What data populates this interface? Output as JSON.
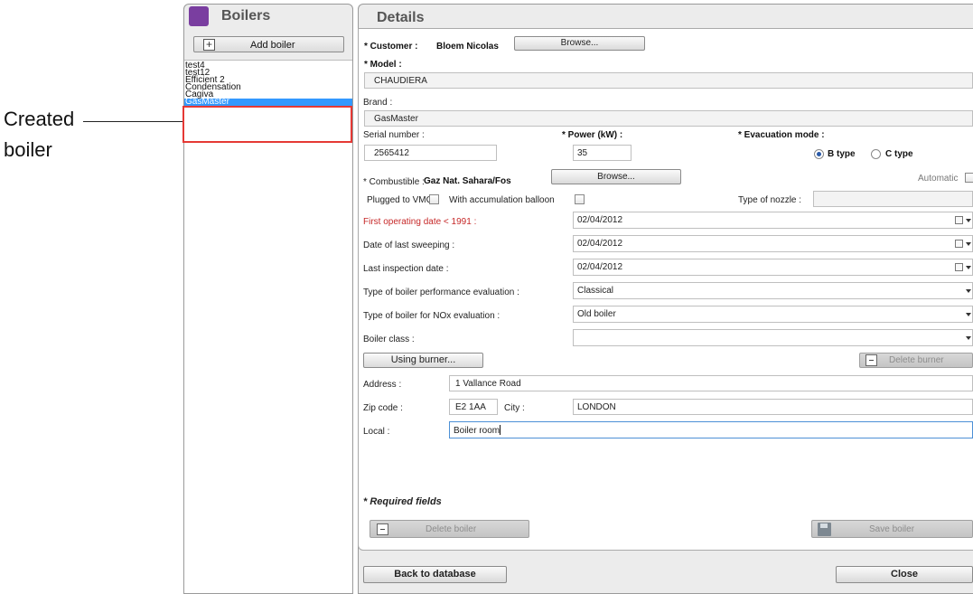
{
  "annotation": {
    "line1": "Created",
    "line2": "boiler"
  },
  "boilers_panel": {
    "title": "Boilers",
    "add_label": "Add boiler",
    "items": [
      {
        "label": "test4"
      },
      {
        "label": "test12"
      },
      {
        "label": "Efficient 2"
      },
      {
        "label": "Condensation"
      },
      {
        "label": "Cagiva"
      },
      {
        "label": "GasMaster",
        "selected": true
      }
    ]
  },
  "details": {
    "title": "Details",
    "customer": {
      "label": "Customer :",
      "value": "Bloem Nicolas",
      "browse_label": "Browse..."
    },
    "model": {
      "label": "Model :",
      "value": "CHAUDIERA"
    },
    "brand": {
      "label": "Brand :",
      "value": "GasMaster"
    },
    "serial": {
      "label": "Serial number :",
      "value": "2565412"
    },
    "power": {
      "label": "Power (kW) :",
      "value": "35"
    },
    "evacuation": {
      "label": "Evacuation mode :",
      "options": [
        "B type",
        "C type"
      ],
      "selected": "B type"
    },
    "combustible": {
      "label": "Combustible :",
      "value": "Gaz Nat. Sahara/Fos",
      "browse_label": "Browse..."
    },
    "automatic_label": "Automatic",
    "plugged_vmc_label": "Plugged to VMC",
    "accumulation_label": "With accumulation balloon",
    "nozzle_label": "Type of nozzle :",
    "first_operating": {
      "label": "First operating date < 1991 :",
      "value": "02/04/2012"
    },
    "last_sweeping": {
      "label": "Date of last sweeping :",
      "value": "02/04/2012"
    },
    "last_inspection": {
      "label": "Last inspection date :",
      "value": "02/04/2012"
    },
    "performance_eval": {
      "label": "Type of boiler performance evaluation :",
      "value": "Classical"
    },
    "nox_eval": {
      "label": "Type of boiler for NOx evaluation :",
      "value": "Old boiler"
    },
    "boiler_class": {
      "label": "Boiler class :",
      "value": ""
    },
    "using_burner_label": "Using burner...",
    "delete_burner_label": "Delete burner",
    "address": {
      "label": "Address :",
      "value": "1 Vallance Road"
    },
    "zip": {
      "label": "Zip code :",
      "value": "E2 1AA"
    },
    "city": {
      "label": "City :",
      "value": "LONDON"
    },
    "local": {
      "label": "Local :",
      "value": "Boiler room"
    },
    "required_note": "* Required fields",
    "delete_boiler_label": "Delete boiler",
    "save_boiler_label": "Save boiler"
  },
  "footer": {
    "back_label": "Back to database",
    "close_label": "Close"
  },
  "colors": {
    "selection": "#3399ff",
    "highlight_box": "#e53935",
    "warning_label": "#c62828",
    "panel_icon": "#7a3ea0"
  },
  "icons": [
    "add-icon",
    "calendar-icon",
    "dropdown-icon",
    "minus-icon",
    "disk-icon",
    "boilers-app-icon"
  ]
}
